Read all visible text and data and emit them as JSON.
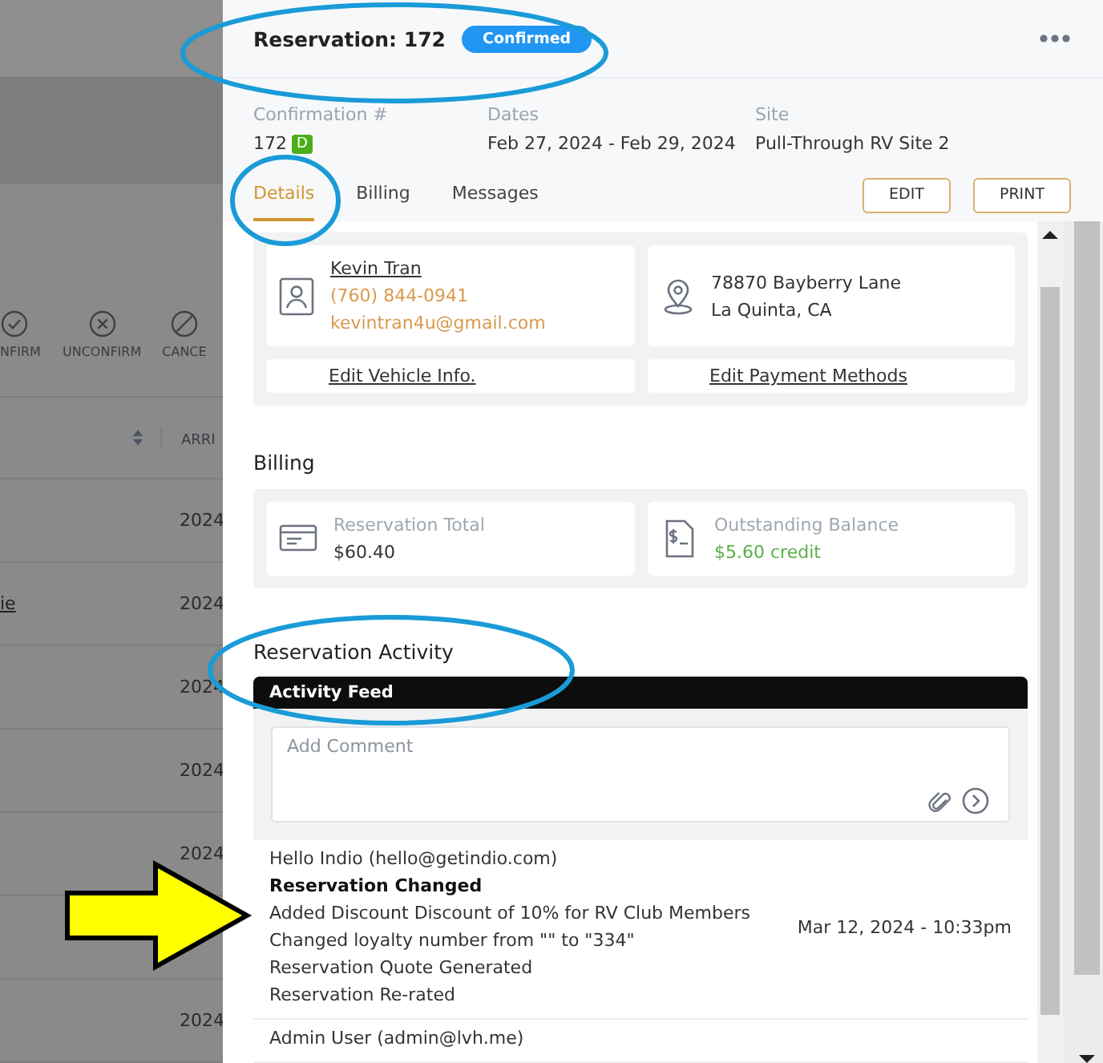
{
  "background": {
    "toolbar": [
      {
        "kind": "confirm",
        "label": "NFIRM"
      },
      {
        "kind": "unconfirm",
        "label": "UNCONFIRM"
      },
      {
        "kind": "cancel",
        "label": "CANCE"
      }
    ],
    "columns": [
      {
        "label": "ARRI"
      }
    ],
    "rows": [
      {
        "column_2": "2024"
      },
      {
        "column_1": "ie",
        "column_2": "2024"
      },
      {
        "column_2": "2024"
      },
      {
        "column_2": "2024"
      },
      {
        "column_2": "2024"
      },
      {},
      {
        "column_2": "2024"
      }
    ]
  },
  "reservation": {
    "title": "Reservation: 172",
    "status": "Confirmed",
    "fields": [
      {
        "label": "Confirmation #",
        "value": "172",
        "badge": "D"
      },
      {
        "label": "Dates",
        "value": "Feb 27, 2024 - Feb 29, 2024"
      },
      {
        "label": "Site",
        "value": "Pull-Through RV Site 2"
      }
    ],
    "tabs": [
      {
        "label": "Details",
        "selected": true
      },
      {
        "label": "Billing",
        "selected": false
      },
      {
        "label": "Messages",
        "selected": false
      }
    ],
    "buttons": [
      "EDIT",
      "PRINT"
    ]
  },
  "guest": {
    "name": "Kevin Tran",
    "phone": "(760) 844-0941",
    "email": "kevintran4u@gmail.com",
    "address": [
      "78870 Bayberry Lane",
      "La Quinta, CA"
    ],
    "links": [
      "Edit Vehicle Info.",
      "Edit Payment Methods"
    ]
  },
  "billing": {
    "title": "Billing",
    "items": [
      {
        "kind": "total",
        "label": "Reservation Total",
        "value": "$60.40"
      },
      {
        "kind": "credit",
        "label": "Outstanding Balance",
        "value": "$5.60 credit"
      }
    ]
  },
  "activity": {
    "title": "Reservation Activity",
    "feed_title": "Activity Feed",
    "comment": {
      "placeholder": "Add Comment"
    },
    "entries": [
      {
        "author": "Hello Indio (hello@getindio.com)",
        "heading": "Reservation Changed",
        "lines": [
          "Added Discount Discount of 10% for RV Club Members",
          "Changed loyalty number from \"\" to \"334\"",
          "Reservation Quote Generated",
          "Reservation Re-rated"
        ],
        "time": "Mar 12, 2024 - 10:33pm"
      },
      {
        "author": "Admin User (admin@lvh.me)"
      }
    ]
  }
}
